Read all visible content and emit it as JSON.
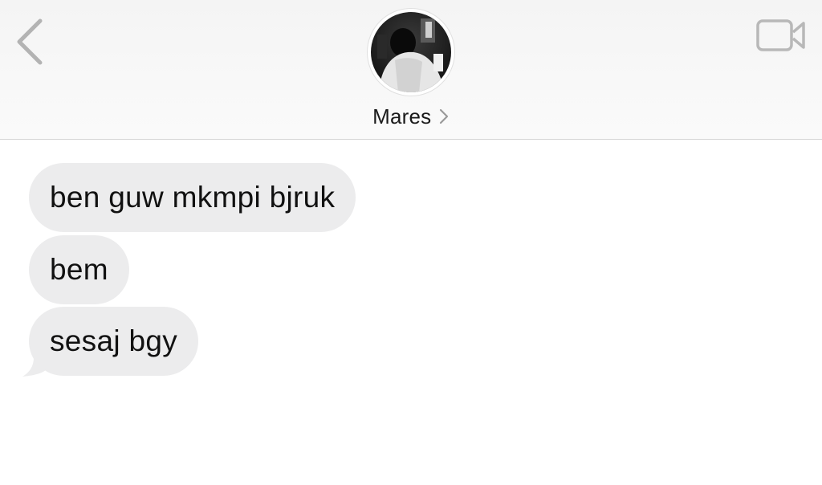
{
  "header": {
    "contact_name": "Mares",
    "icons": {
      "back": "chevron-left-icon",
      "video": "video-camera-icon",
      "name_chevron": "chevron-right-icon"
    }
  },
  "messages": [
    {
      "text": "ben guw mkmpi bjruk",
      "direction": "incoming"
    },
    {
      "text": "bem",
      "direction": "incoming"
    },
    {
      "text": "sesaj bgy",
      "direction": "incoming"
    }
  ],
  "colors": {
    "incoming_bubble": "#ececed",
    "icon_gray": "#b8b8b8",
    "text": "#111111"
  }
}
